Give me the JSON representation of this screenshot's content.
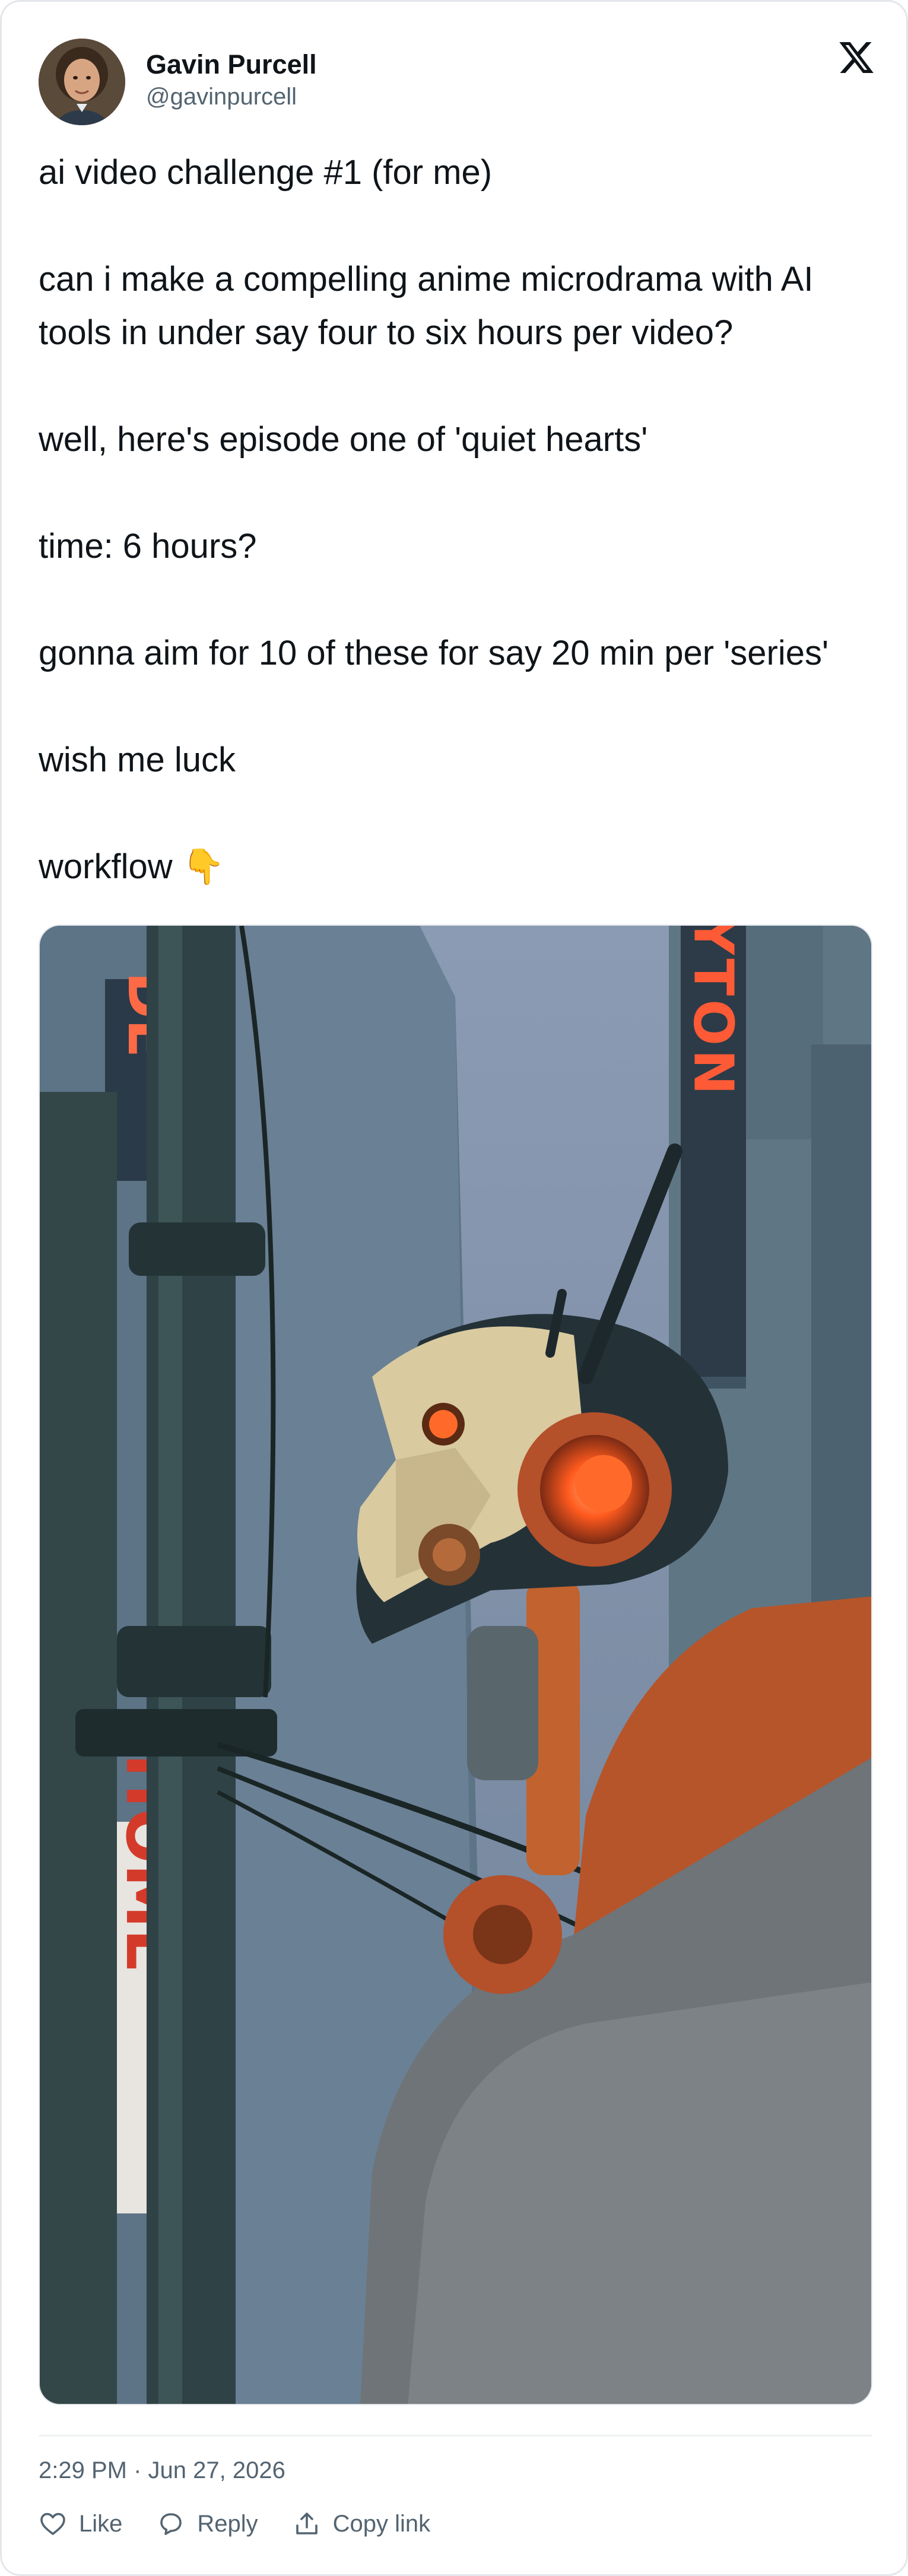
{
  "author": {
    "name": "Gavin Purcell",
    "handle": "@gavinpurcell"
  },
  "tweet": {
    "paragraphs": [
      "ai video challenge #1 (for me)",
      "can i make a compelling anime microdrama with AI tools in under say four to six hours per video?",
      "well, here's episode one of 'quiet hearts'",
      "time: 6 hours?",
      "gonna aim for 10 of these for say 20 min per 'series'",
      "wish me luck",
      "workflow 👇"
    ]
  },
  "media": {
    "sign_left": "DE",
    "sign_right": "ZOЯYTON",
    "sign_lower": "HOME"
  },
  "meta": {
    "timestamp": "2:29 PM · Jun 27, 2026"
  },
  "actions": {
    "like": "Like",
    "reply": "Reply",
    "copy_link": "Copy link"
  },
  "colors": {
    "text": "#0f1419",
    "secondary": "#536471",
    "border": "#e3e6ea",
    "neon": "#ff5a36"
  }
}
